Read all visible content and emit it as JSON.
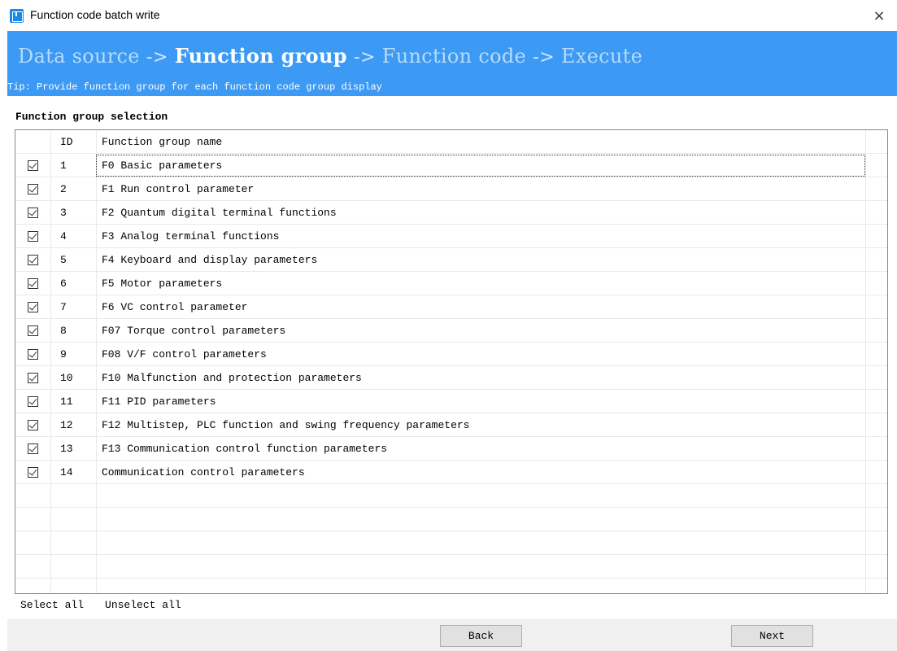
{
  "window": {
    "title": "Function code batch write",
    "close_glyph": "×",
    "icon": "app-icon"
  },
  "steps": {
    "items": [
      {
        "label": "Data source",
        "active": false
      },
      {
        "label": "Function group",
        "active": true
      },
      {
        "label": "Function code",
        "active": false
      },
      {
        "label": "Execute",
        "active": false
      }
    ],
    "separator": "->",
    "s0": "Data source",
    "s1": "Function group",
    "s2": "Function code",
    "s3": "Execute"
  },
  "tip": "Tip:  Provide function group for each function code group display",
  "section_title": "Function group selection",
  "table": {
    "headers": {
      "id": "ID",
      "name": "Function group name"
    },
    "rows": [
      {
        "id": "1",
        "name": "F0 Basic parameters",
        "checked": true
      },
      {
        "id": "2",
        "name": "F1 Run control parameter",
        "checked": true
      },
      {
        "id": "3",
        "name": "F2 Quantum digital terminal functions",
        "checked": true
      },
      {
        "id": "4",
        "name": "F3 Analog terminal functions",
        "checked": true
      },
      {
        "id": "5",
        "name": "F4 Keyboard and display parameters",
        "checked": true
      },
      {
        "id": "6",
        "name": "F5 Motor parameters",
        "checked": true
      },
      {
        "id": "7",
        "name": "F6 VC control parameter",
        "checked": true
      },
      {
        "id": "8",
        "name": "F07 Torque control parameters",
        "checked": true
      },
      {
        "id": "9",
        "name": "F08 V/F control parameters",
        "checked": true
      },
      {
        "id": "10",
        "name": "F10 Malfunction and protection parameters",
        "checked": true
      },
      {
        "id": "11",
        "name": "F11 PID parameters",
        "checked": true
      },
      {
        "id": "12",
        "name": "F12 Multistep, PLC function and swing frequency parameters",
        "checked": true
      },
      {
        "id": "13",
        "name": "F13 Communication control function parameters",
        "checked": true
      },
      {
        "id": "14",
        "name": "Communication control parameters",
        "checked": true
      }
    ],
    "empty_rows": 5
  },
  "links": {
    "select_all": "Select all",
    "unselect_all": "Unselect all"
  },
  "buttons": {
    "back": "Back",
    "next": "Next"
  },
  "colors": {
    "banner": "#3c9af4",
    "accent": "#1e88e5"
  }
}
